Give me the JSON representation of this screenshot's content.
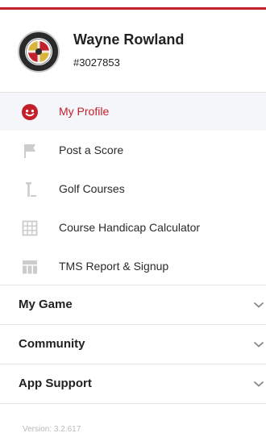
{
  "colors": {
    "accent": "#c3202a",
    "active_background": "#f4f6fa",
    "icon_gray": "#cccccc",
    "divider": "#e4e4e4",
    "version_text": "#b9b9b9"
  },
  "profile": {
    "name": "Wayne Rowland",
    "member_id": "#3027853",
    "avatar_icon": "club-seal-icon"
  },
  "nav": {
    "items": [
      {
        "label": "My Profile",
        "icon": "smiley-face-icon",
        "active": true
      },
      {
        "label": "Post a Score",
        "icon": "flag-icon",
        "active": false
      },
      {
        "label": "Golf Courses",
        "icon": "golf-tee-icon",
        "active": false
      },
      {
        "label": "Course Handicap Calculator",
        "icon": "grid-calculator-icon",
        "active": false
      },
      {
        "label": "TMS Report & Signup",
        "icon": "table-icon",
        "active": false
      }
    ]
  },
  "sections": [
    {
      "label": "My Game",
      "icon": "chevron-down-icon"
    },
    {
      "label": "Community",
      "icon": "chevron-down-icon"
    },
    {
      "label": "App Support",
      "icon": "chevron-down-icon"
    }
  ],
  "footer": {
    "version": "Version: 3.2.617"
  }
}
